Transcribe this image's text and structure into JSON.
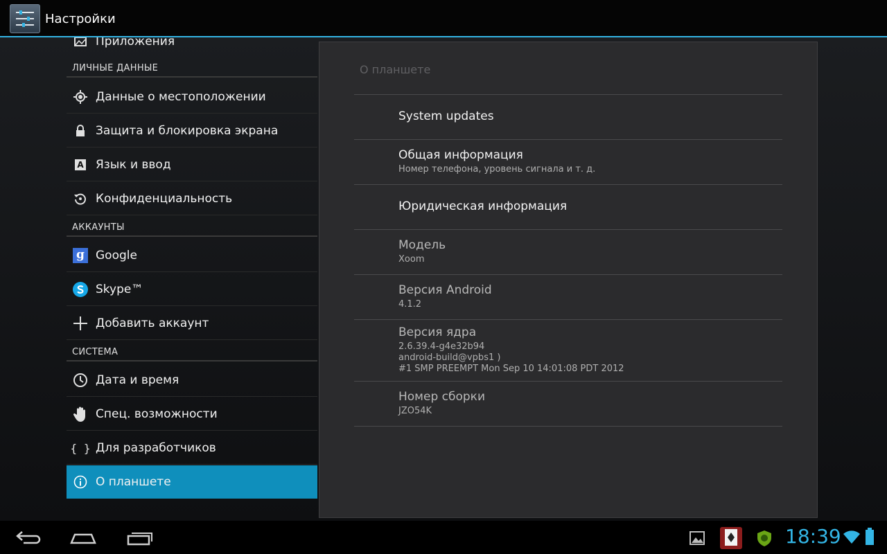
{
  "app_title": "Настройки",
  "left": {
    "apps_label": "Приложения",
    "personal_header": "ЛИЧНЫЕ ДАННЫЕ",
    "location": "Данные о местоположении",
    "security": "Защита и блокировка экрана",
    "language": "Язык и ввод",
    "privacy": "Конфиденциальность",
    "accounts_header": "АККАУНТЫ",
    "google": "Google",
    "google_icon_letter": "g",
    "skype": "Skype™",
    "add_account": "Добавить аккаунт",
    "system_header": "СИСТЕМА",
    "datetime": "Дата и время",
    "accessibility": "Спец. возможности",
    "developer": "Для разработчиков",
    "developer_icon_text": "{ }",
    "about": "О планшете"
  },
  "right": {
    "title": "О планшете",
    "system_updates": "System updates",
    "general_info": "Общая информация",
    "general_info_sub": "Номер телефона, уровень сигнала и т. д.",
    "legal": "Юридическая информация",
    "model_label": "Модель",
    "model_value": "Xoom",
    "android_label": "Версия Android",
    "android_value": "4.1.2",
    "kernel_label": "Версия ядра",
    "kernel_line1": "2.6.39.4-g4e32b94",
    "kernel_line2": "android-build@vpbs1 )",
    "kernel_line3": "#1 SMP PREEMPT Mon Sep 10 14:01:08 PDT 2012",
    "build_label": "Номер сборки",
    "build_value": "JZO54K"
  },
  "status": {
    "clock": "18:39"
  },
  "colors": {
    "accent": "#33b5e5",
    "selected": "#0f8fbc"
  }
}
